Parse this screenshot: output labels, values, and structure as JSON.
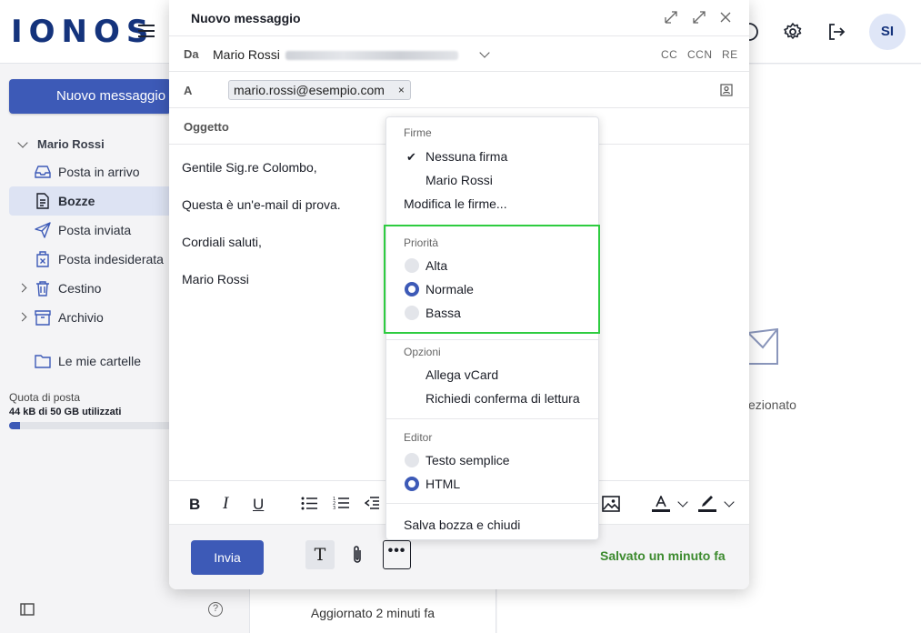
{
  "header": {
    "logo": "IONOS",
    "avatar_initials": "SI"
  },
  "sidebar": {
    "new_message": "Nuovo messaggio",
    "account": "Mario Rossi",
    "folders": [
      {
        "label": "Posta in arrivo"
      },
      {
        "label": "Bozze"
      },
      {
        "label": "Posta inviata"
      },
      {
        "label": "Posta indesiderata"
      },
      {
        "label": "Cestino"
      },
      {
        "label": "Archivio"
      },
      {
        "label": "Le mie cartelle"
      }
    ],
    "quota_label": "Quota di posta",
    "quota_value": "44 kB di 50 GB utilizzati",
    "quota_fraction": 0.07
  },
  "mail_list": {
    "status": "Aggiornato 2 minuti fa"
  },
  "preview": {
    "partial_text": "ezionato"
  },
  "compose": {
    "title": "Nuovo messaggio",
    "from_label": "Da",
    "from_name": "Mario Rossi",
    "cc": "CC",
    "ccn": "CCN",
    "re": "RE",
    "to_label": "A",
    "to_chip": "mario.rossi@esempio.com",
    "chip_remove": "×",
    "subject_placeholder": "Oggetto",
    "body": [
      "Gentile Sig.re Colombo,",
      "Questa è un'e-mail di prova.",
      "Cordiali saluti,",
      "Mario Rossi"
    ],
    "send": "Invia",
    "text_btn": "T",
    "more": "•••",
    "saved": "Salvato un minuto fa"
  },
  "menu": {
    "signatures_header": "Firme",
    "signatures": [
      "Nessuna firma",
      "Mario Rossi"
    ],
    "signature_selected": "Nessuna firma",
    "edit_signatures": "Modifica le firme...",
    "priority_header": "Priorità",
    "priorities": [
      "Alta",
      "Normale",
      "Bassa"
    ],
    "priority_selected": "Normale",
    "options_header": "Opzioni",
    "options": [
      "Allega vCard",
      "Richiedi conferma di lettura"
    ],
    "editor_header": "Editor",
    "editors": [
      "Testo semplice",
      "HTML"
    ],
    "editor_selected": "HTML",
    "save_close": "Salva bozza e chiudi"
  },
  "colors": {
    "accent": "#3d5ab7",
    "saved_green": "#3c8a2e",
    "highlight": "#2ecc40"
  }
}
